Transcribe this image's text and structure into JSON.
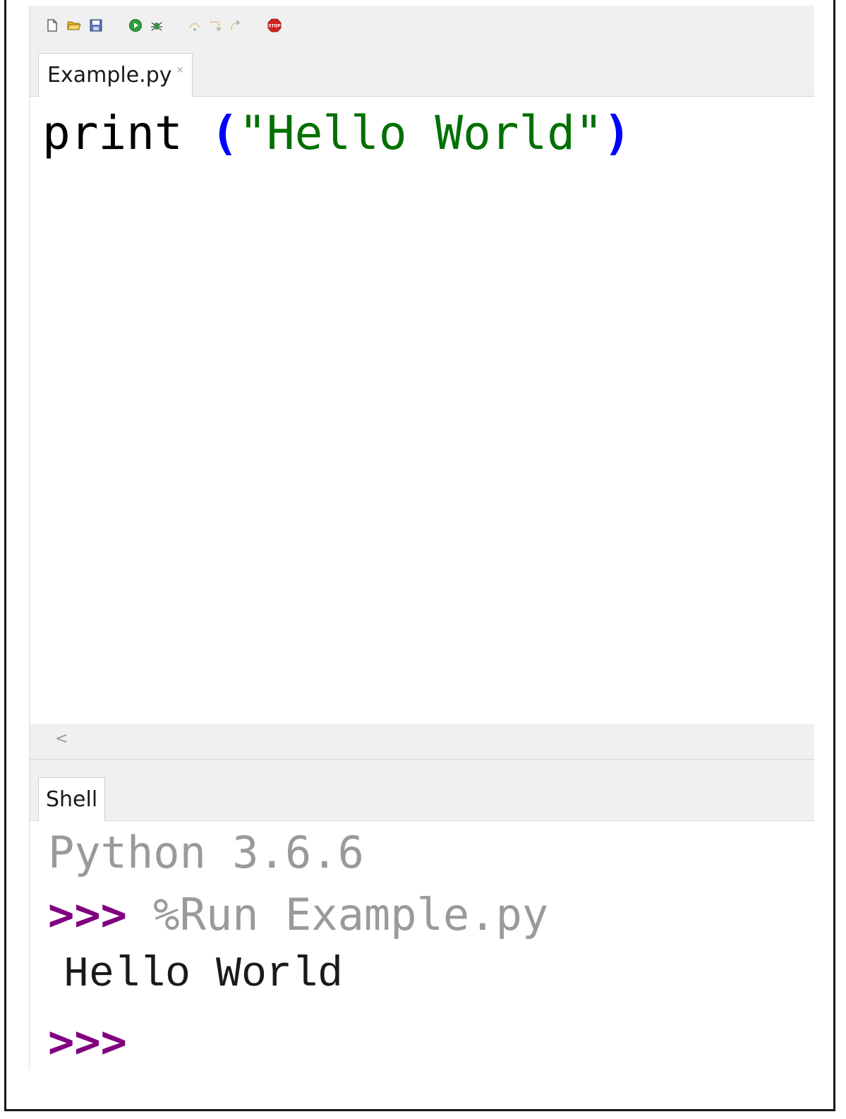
{
  "toolbar": {
    "buttons": [
      {
        "icon": "new-file-icon"
      },
      {
        "icon": "open-folder-icon"
      },
      {
        "icon": "save-icon"
      },
      {
        "icon": "run-icon"
      },
      {
        "icon": "debug-bug-icon"
      },
      {
        "icon": "step-over-icon"
      },
      {
        "icon": "step-into-icon"
      },
      {
        "icon": "step-out-icon"
      },
      {
        "icon": "stop-icon",
        "label": "STOP"
      }
    ]
  },
  "editor": {
    "tab": {
      "label": "Example.py",
      "close": "×"
    },
    "code": {
      "keyword": "print",
      "space": " ",
      "open_paren": "(",
      "string": "\"Hello World\"",
      "close_paren": ")"
    },
    "scrollbar": {
      "left_arrow": "<"
    }
  },
  "shell": {
    "tab": {
      "label": "Shell"
    },
    "banner": "Python 3.6.6",
    "prompt": ">>>",
    "command": " %Run Example.py",
    "output": "Hello World",
    "prompt2": ">>>"
  },
  "colors": {
    "keyword": "#000000",
    "paren": "#0000ff",
    "string": "#007000",
    "prompt": "#800080",
    "muted": "#9a9a9a",
    "toolbar_bg": "#f0f0f0"
  }
}
